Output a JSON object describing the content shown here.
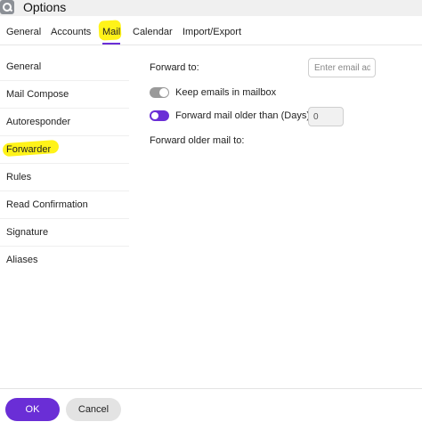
{
  "window": {
    "title": "Options"
  },
  "tabs": [
    {
      "label": "General"
    },
    {
      "label": "Accounts"
    },
    {
      "label": "Mail",
      "active": true
    },
    {
      "label": "Calendar"
    },
    {
      "label": "Import/Export"
    }
  ],
  "sidebar": {
    "items": [
      {
        "label": "General"
      },
      {
        "label": "Mail Compose"
      },
      {
        "label": "Autoresponder"
      },
      {
        "label": "Forwarder",
        "selected": true
      },
      {
        "label": "Rules"
      },
      {
        "label": "Read Confirmation"
      },
      {
        "label": "Signature"
      },
      {
        "label": "Aliases"
      }
    ]
  },
  "forwarder": {
    "forward_to_label": "Forward to:",
    "email_placeholder": "Enter email address",
    "email_value": "",
    "keep_emails_label": "Keep emails in mailbox",
    "keep_emails_on": false,
    "forward_older_label": "Forward mail older than (Days):",
    "forward_older_on": true,
    "days_value": "0",
    "forward_older_to_label": "Forward older mail to:"
  },
  "footer": {
    "ok_label": "OK",
    "cancel_label": "Cancel"
  },
  "colors": {
    "accent": "#6a2ed6",
    "highlight": "#fff200"
  },
  "icons": {
    "app": "search-icon"
  }
}
